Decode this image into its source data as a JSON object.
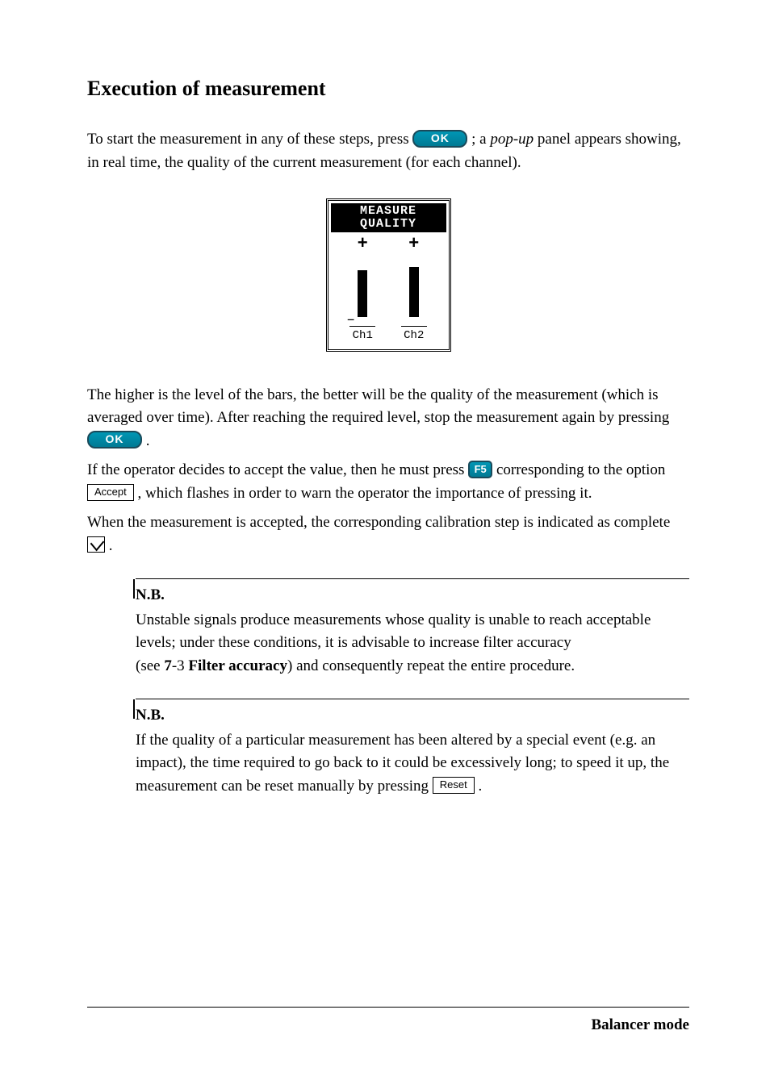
{
  "heading": "Execution of measurement",
  "p1_a": "To start the measurement in any of these steps, press ",
  "btn_ok": "OK",
  "p1_b": " ; a ",
  "p1_popup": "pop-up",
  "p1_c": " panel appears showing, in real time, the quality of the current measurement (for each channel).",
  "popup": {
    "title_l1": "MEASURE",
    "title_l2": "QUALITY",
    "ch1": "Ch1",
    "ch2": "Ch2"
  },
  "p2": "The higher is the level of the bars, the better will be the quality of the measurement (which is averaged over time). After reaching the required level,  stop the measurement again by pressing ",
  "p2_end": " .",
  "p3_a": "If the operator decides to accept the  value, then he must  press  ",
  "btn_f5": "F5",
  "p3_b": " corresponding to the option  ",
  "btn_accept": "Accept",
  "p3_c": "  , which flashes in order to warn the operator the importance of pressing it.",
  "p4_a": "When the measurement is accepted, the corresponding calibration step is indicated as complete  ",
  "p4_b": " .",
  "nb1": {
    "title": "N.B.",
    "l1": "Unstable signals produce measurements whose quality is unable to reach acceptable levels; under these conditions, it is advisable to increase filter accuracy",
    "l2a": "(see ",
    "l2b": "7",
    "l2c": "-3 ",
    "l2d": "Filter accuracy",
    "l2e": ") and consequently repeat the entire procedure."
  },
  "nb2": {
    "title": "N.B.",
    "l1": "If the quality of a particular measurement has been altered by a special event  (e.g. an impact), the time required to go back to it could be excessively long; to speed it up, the measurement can be reset manually by pressing ",
    "btn_reset": "Reset",
    "l2": " ."
  },
  "footer": "Balancer mode"
}
